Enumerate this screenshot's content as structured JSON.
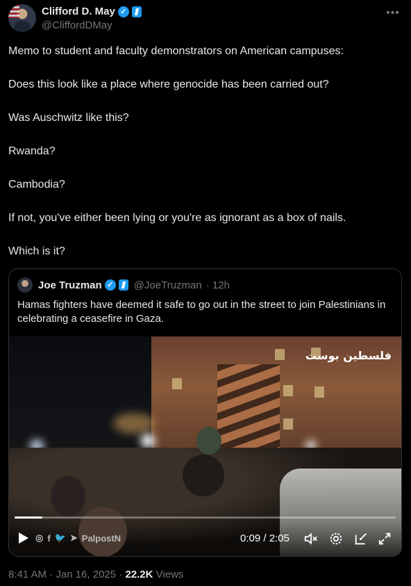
{
  "author": {
    "display_name": "Clifford D. May",
    "handle": "@CliffordDMay",
    "more_icon": "ellipsis-icon"
  },
  "tweet": {
    "paragraphs": [
      "Memo to student and faculty demonstrators on American campuses:",
      "Does this look like a place where genocide has been carried out?",
      "Was Auschwitz like this?",
      "Rwanda?",
      "Cambodia?",
      "If not, you've either been lying or you're as ignorant as a box of nails.",
      "Which is it?"
    ]
  },
  "quote": {
    "display_name": "Joe Truzman",
    "handle": "@JoeTruzman",
    "time": "· 12h",
    "text": "Hamas fighters have deemed it safe to go out in the street to join Palestinians in celebrating a ceasefire in Gaza.",
    "video": {
      "watermark": "فلسطين بوست",
      "source_label": "PalpostN",
      "time": "0:09 / 2:05",
      "progress": 0.072
    }
  },
  "meta": {
    "timestamp": "8:41 AM · Jan 16, 2025 ·",
    "views_count": "22.2K",
    "views_label": "Views"
  },
  "colors": {
    "background": "#000000",
    "text": "#e7e9ea",
    "secondary": "#71767b",
    "verified": "#1d9bf0",
    "border": "#2f3336"
  }
}
